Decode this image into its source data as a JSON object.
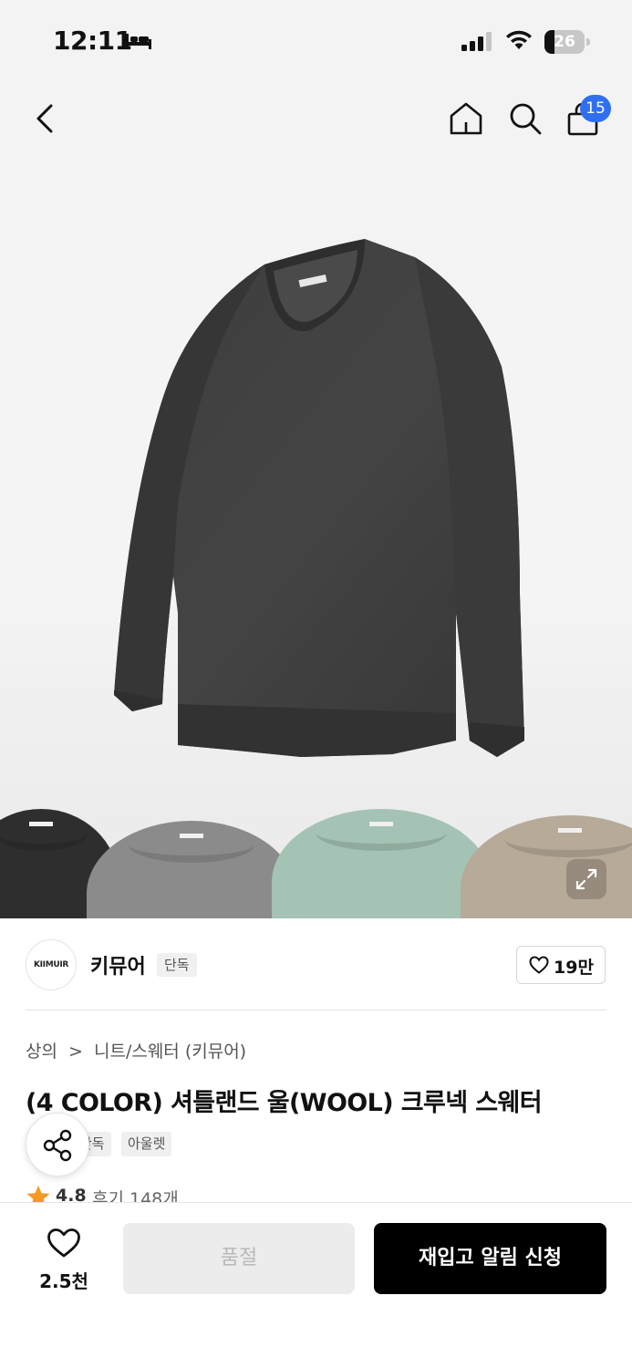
{
  "status_bar": {
    "time": "12:11",
    "battery_level": "26",
    "battery_percent": 26
  },
  "nav": {
    "icons": [
      "back-icon",
      "home-icon",
      "search-icon",
      "shopping-bag-icon"
    ],
    "cart_count": "15"
  },
  "product_images": {
    "color_swatches": [
      "#2e2e2e",
      "#8b8b8b",
      "#a4c3b4",
      "#b7aa99"
    ],
    "expand_icon": "expand-icon"
  },
  "brand": {
    "logo_text": "KIIMUIR",
    "name": "키뮤어",
    "tag": "단독",
    "likes": "19만"
  },
  "product": {
    "breadcrumb": [
      "상의",
      "니트/스웨터 (키뮤어)"
    ],
    "breadcrumb_separator": ">",
    "title": "(4 COLOR) 셔틀랜드 울(WOOL) 크루넥 스웨터",
    "tags": [
      "단독",
      "아울렛"
    ],
    "rating": "4.8",
    "reviews": "후기 148개"
  },
  "bottom_bar": {
    "wish_count": "2.5천",
    "soldout_label": "품절",
    "restock_label": "재입고 알림 신청"
  },
  "colors": {
    "badge_blue": "#2f6ff0",
    "star_orange": "#f59a23",
    "primary_button": "#000000"
  }
}
